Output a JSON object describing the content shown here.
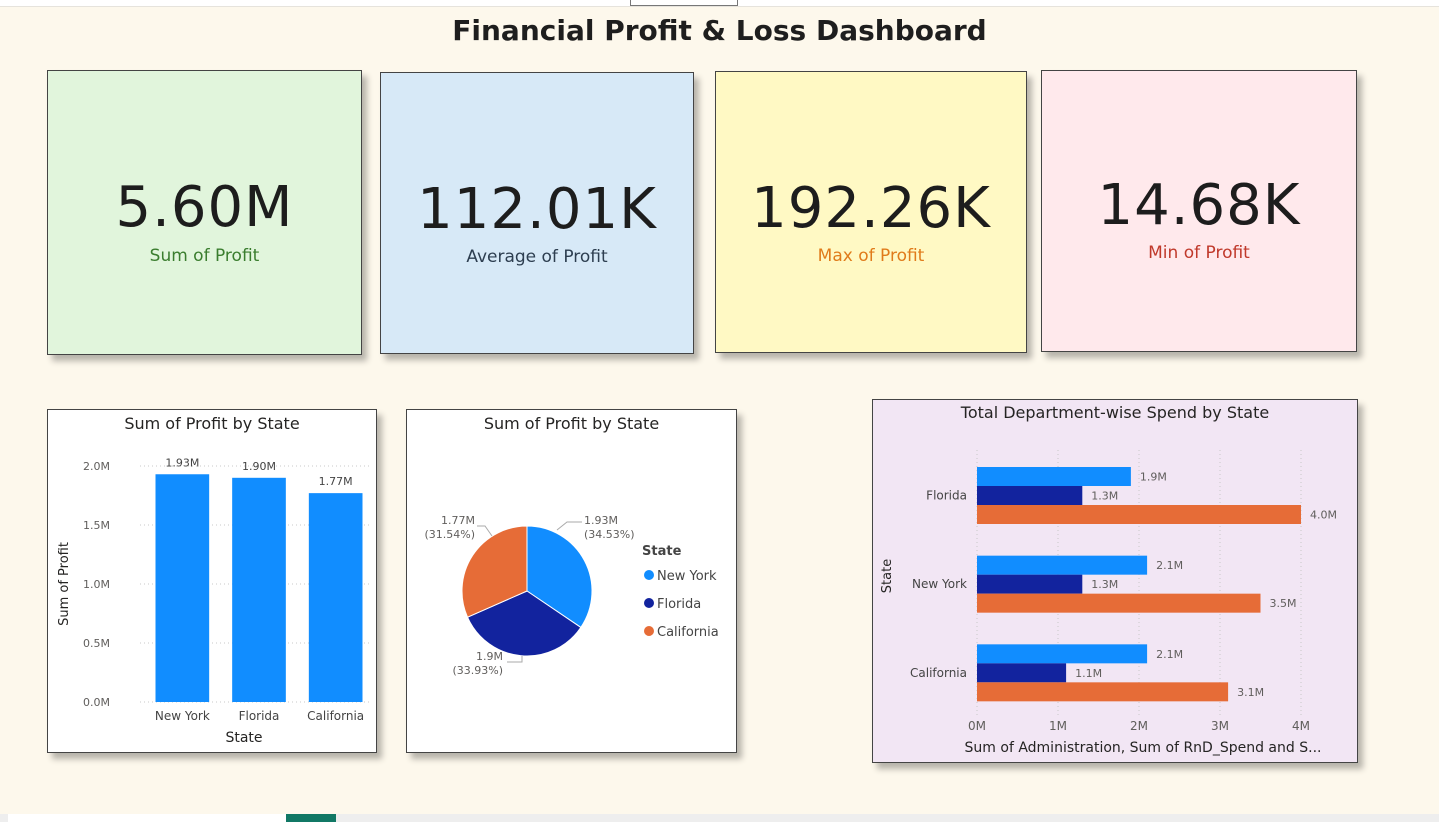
{
  "dashboard_title": "Financial Profit & Loss Dashboard",
  "kpis": [
    {
      "value": "5.60M",
      "label": "Sum of Profit",
      "bg": "#e1f5dc",
      "label_color": "#3a7d2e"
    },
    {
      "value": "112.01K",
      "label": "Average of Profit",
      "bg": "#d7e9f7",
      "label_color": "#2d3e50"
    },
    {
      "value": "192.26K",
      "label": "Max of Profit",
      "bg": "#fff9c4",
      "label_color": "#e07b1a"
    },
    {
      "value": "14.68K",
      "label": "Min of Profit",
      "bg": "#ffe9ec",
      "label_color": "#c0392b"
    }
  ],
  "colors": {
    "blue": "#118dff",
    "navy": "#12239e",
    "orange": "#e66c37",
    "purple_bg": "#f2e6f4"
  },
  "chart_data": [
    {
      "type": "bar",
      "title": "Sum of Profit by State",
      "xlabel": "State",
      "ylabel": "Sum of Profit",
      "categories": [
        "New York",
        "Florida",
        "California"
      ],
      "values": [
        1.93,
        1.9,
        1.77
      ],
      "data_labels": [
        "1.93M",
        "1.90M",
        "1.77M"
      ],
      "ylim": [
        0,
        2.0
      ],
      "yticks": [
        "0.0M",
        "0.5M",
        "1.0M",
        "1.5M",
        "2.0M"
      ],
      "grid": true
    },
    {
      "type": "pie",
      "title": "Sum of Profit by State",
      "legend_title": "State",
      "legend_position": "right",
      "slices": [
        {
          "name": "New York",
          "value": 1.93,
          "label": "1.93M",
          "pct": "(34.53%)",
          "color": "#118dff"
        },
        {
          "name": "Florida",
          "value": 1.9,
          "label": "1.9M",
          "pct": "(33.93%)",
          "color": "#12239e"
        },
        {
          "name": "California",
          "value": 1.77,
          "label": "1.77M",
          "pct": "(31.54%)",
          "color": "#e66c37"
        }
      ]
    },
    {
      "type": "bar",
      "orientation": "horizontal",
      "title": "Total Department-wise Spend by State",
      "xlabel": "Sum of Administration, Sum of RnD_Spend and S...",
      "ylabel": "State",
      "categories": [
        "Florida",
        "New York",
        "California"
      ],
      "series": [
        {
          "values": [
            1.9,
            2.1,
            2.1
          ],
          "labels": [
            "1.9M",
            "2.1M",
            "2.1M"
          ],
          "color": "#118dff"
        },
        {
          "values": [
            1.3,
            1.3,
            1.1
          ],
          "labels": [
            "1.3M",
            "1.3M",
            "1.1M"
          ],
          "color": "#12239e"
        },
        {
          "values": [
            4.0,
            3.5,
            3.1
          ],
          "labels": [
            "4.0M",
            "3.5M",
            "3.1M"
          ],
          "color": "#e66c37"
        }
      ],
      "xlim": [
        0,
        4
      ],
      "xticks": [
        "0M",
        "1M",
        "2M",
        "3M",
        "4M"
      ],
      "grid": true
    }
  ]
}
